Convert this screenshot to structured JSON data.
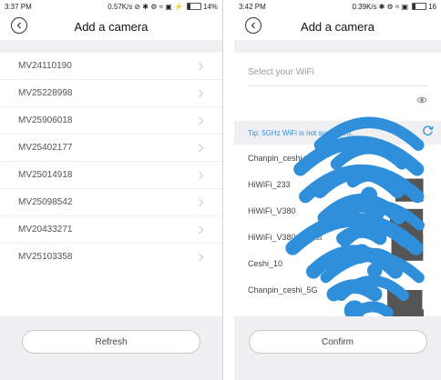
{
  "left": {
    "status": {
      "time": "3:37 PM",
      "speed": "0.57K/s",
      "battery": "14%"
    },
    "nav": {
      "title": "Add a camera"
    },
    "cameras": [
      "MV24110190",
      "MV25228998",
      "MV25906018",
      "MV25402177",
      "MV25014918",
      "MV25098542",
      "MV20433271",
      "MV25103358"
    ],
    "refresh_label": "Refresh"
  },
  "right": {
    "status": {
      "time": "3:42 PM",
      "speed": "0.39K/s",
      "battery": "16"
    },
    "nav": {
      "title": "Add a camera"
    },
    "wifi_placeholder": "Select your WiFi",
    "tip": "Tip: 5GHz WiFi is not supported.",
    "networks": [
      {
        "name": "Chanpin_ceshi+1",
        "locked": true
      },
      {
        "name": "HiWiFi_233",
        "locked": true
      },
      {
        "name": "HiWiFi_V380",
        "locked": true
      },
      {
        "name": "HiWiFi_V380_Guest",
        "locked": false
      },
      {
        "name": "Ceshi_10",
        "locked": true
      },
      {
        "name": "Chanpin_ceshi_5G",
        "locked": true
      }
    ],
    "confirm_label": "Confirm"
  },
  "colors": {
    "accent": "#2f8fda",
    "bottom_bg": "#f0f0f2",
    "tip": "#3a8ad8"
  }
}
